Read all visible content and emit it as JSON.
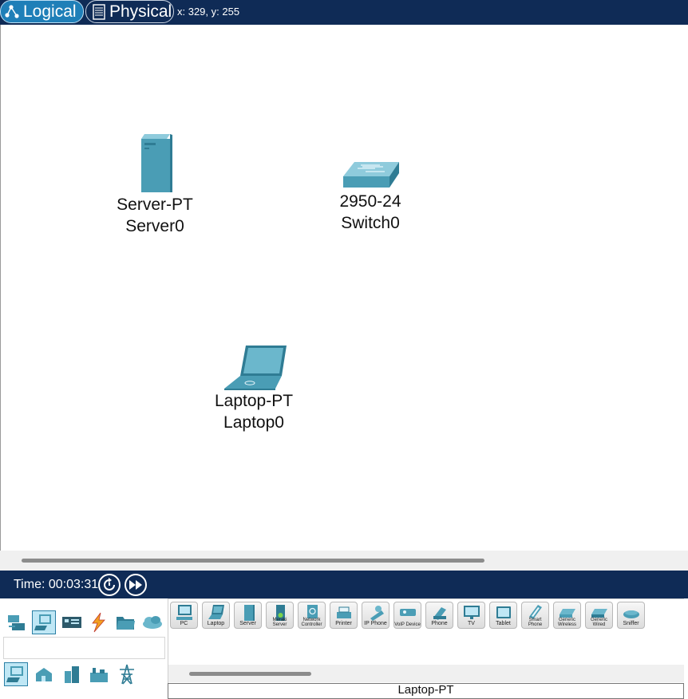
{
  "tabs": {
    "logical": "Logical",
    "physical": "Physical"
  },
  "coords": "x: 329, y: 255",
  "devices": {
    "server": {
      "model": "Server-PT",
      "name": "Server0"
    },
    "switch": {
      "model": "2950-24",
      "name": "Switch0"
    },
    "laptop": {
      "model": "Laptop-PT",
      "name": "Laptop0"
    }
  },
  "time": {
    "text": "Time: 00:03:31"
  },
  "palette": {
    "items": [
      {
        "label": "PC"
      },
      {
        "label": "Laptop"
      },
      {
        "label": "Server"
      },
      {
        "label": "Meraki Server"
      },
      {
        "label": "Network Controller"
      },
      {
        "label": "Printer"
      },
      {
        "label": "IP Phone"
      },
      {
        "label": "VoIP Device"
      },
      {
        "label": "Phone"
      },
      {
        "label": "TV"
      },
      {
        "label": "Tablet"
      },
      {
        "label": "Smart Phone"
      },
      {
        "label": "Generic Wireless"
      },
      {
        "label": "Generic Wired"
      },
      {
        "label": "Sniffer"
      }
    ],
    "selected_name": "Laptop-PT"
  },
  "colors": {
    "navy": "#0f2b56",
    "accent": "#1f7fb8",
    "device": "#4a9db5"
  }
}
